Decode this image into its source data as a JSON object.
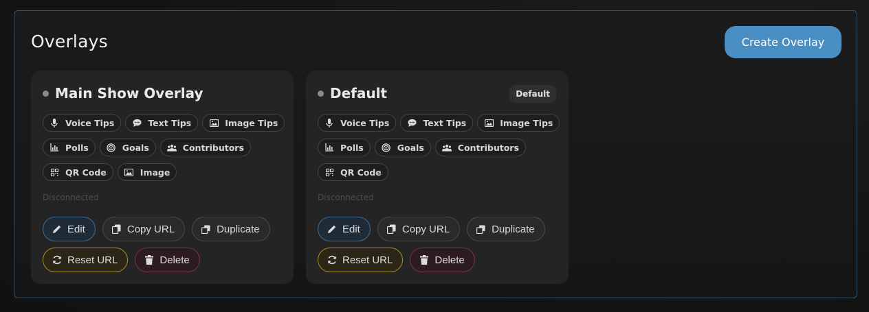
{
  "panel": {
    "title": "Overlays",
    "create_label": "Create Overlay"
  },
  "colors": {
    "accent": "#4a8fc4",
    "reset_border": "#a8922c",
    "delete_border": "#7a3346",
    "edit_border": "#3f6f95"
  },
  "cards": [
    {
      "title": "Main Show Overlay",
      "badge": "",
      "tags": [
        {
          "label": "Voice Tips",
          "icon": "microphone-icon"
        },
        {
          "label": "Text Tips",
          "icon": "chat-bubble-icon"
        },
        {
          "label": "Image Tips",
          "icon": "image-icon"
        },
        {
          "label": "Polls",
          "icon": "bar-chart-icon"
        },
        {
          "label": "Goals",
          "icon": "target-icon"
        },
        {
          "label": "Contributors",
          "icon": "users-icon"
        },
        {
          "label": "QR Code",
          "icon": "qr-code-icon"
        },
        {
          "label": "Image",
          "icon": "image-icon"
        }
      ],
      "status": "Disconnected",
      "actions": {
        "edit": "Edit",
        "copy": "Copy URL",
        "duplicate": "Duplicate",
        "reset": "Reset URL",
        "delete": "Delete"
      }
    },
    {
      "title": "Default",
      "badge": "Default",
      "tags": [
        {
          "label": "Voice Tips",
          "icon": "microphone-icon"
        },
        {
          "label": "Text Tips",
          "icon": "chat-bubble-icon"
        },
        {
          "label": "Image Tips",
          "icon": "image-icon"
        },
        {
          "label": "Polls",
          "icon": "bar-chart-icon"
        },
        {
          "label": "Goals",
          "icon": "target-icon"
        },
        {
          "label": "Contributors",
          "icon": "users-icon"
        },
        {
          "label": "QR Code",
          "icon": "qr-code-icon"
        }
      ],
      "status": "Disconnected",
      "actions": {
        "edit": "Edit",
        "copy": "Copy URL",
        "duplicate": "Duplicate",
        "reset": "Reset URL",
        "delete": "Delete"
      }
    }
  ]
}
